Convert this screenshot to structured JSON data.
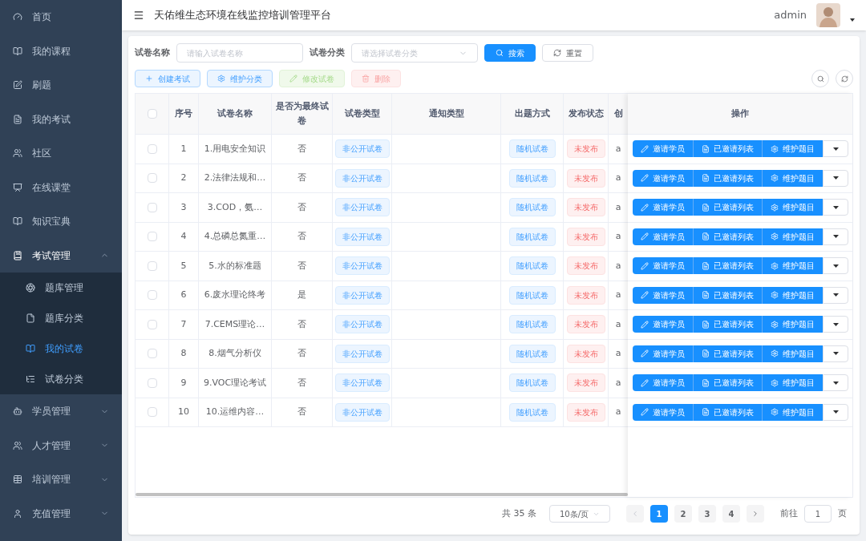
{
  "header": {
    "title": "天佑维生态环境在线监控培训管理平台",
    "user": "admin"
  },
  "sidebar": {
    "items": [
      {
        "label": "首页",
        "selected": false
      },
      {
        "label": "我的课程",
        "selected": false
      },
      {
        "label": "刷题",
        "selected": false
      },
      {
        "label": "我的考试",
        "selected": false
      },
      {
        "label": "社区",
        "selected": false
      },
      {
        "label": "在线课堂",
        "selected": false
      },
      {
        "label": "知识宝典",
        "selected": false
      },
      {
        "label": "考试管理",
        "selected": false,
        "expanded": true,
        "children": [
          {
            "label": "题库管理",
            "selected": false
          },
          {
            "label": "题库分类",
            "selected": false
          },
          {
            "label": "我的试卷",
            "selected": true
          },
          {
            "label": "试卷分类",
            "selected": false
          }
        ]
      },
      {
        "label": "学员管理",
        "selected": false,
        "expanded": false
      },
      {
        "label": "人才管理",
        "selected": false,
        "expanded": false
      },
      {
        "label": "培训管理",
        "selected": false,
        "expanded": false
      },
      {
        "label": "充值管理",
        "selected": false,
        "expanded": false
      }
    ]
  },
  "filters": [
    {
      "kind": "text",
      "label": "试卷名称",
      "placeholder": "请输入试卷名称"
    },
    {
      "kind": "select",
      "label": "试卷分类",
      "placeholder": "请选择试卷分类"
    }
  ],
  "filter_buttons": [
    {
      "kind": "primary",
      "label": "搜索"
    },
    {
      "kind": "default",
      "label": "重置"
    }
  ],
  "toolbar": [
    {
      "kind": "primary",
      "label": "创建考试",
      "disabled": false
    },
    {
      "kind": "primary",
      "label": "维护分类",
      "disabled": false
    },
    {
      "kind": "success",
      "label": "修改试卷",
      "disabled": true
    },
    {
      "kind": "danger",
      "label": "删除",
      "disabled": true
    }
  ],
  "table": {
    "select_all_checked": false,
    "columns": [
      "序号",
      "试卷名称",
      "是否为最终试卷",
      "试卷类型",
      "通知类型",
      "出题方式",
      "发布状态",
      "创",
      "操作"
    ],
    "rows": [
      {
        "checked": false,
        "index": "1",
        "name": "1.用电安全知识",
        "final": "否",
        "paper_type": "非公开试卷",
        "method": "随机试卷",
        "status": "未发布",
        "column_9": "a",
        "actions": [
          "邀请学员",
          "已邀请列表",
          "维护题目"
        ]
      },
      {
        "checked": false,
        "index": "2",
        "name": "2.法律法规和…",
        "final": "否",
        "paper_type": "非公开试卷",
        "method": "随机试卷",
        "status": "未发布",
        "column_9": "a",
        "actions": [
          "邀请学员",
          "已邀请列表",
          "维护题目"
        ]
      },
      {
        "checked": false,
        "index": "3",
        "name": "3.COD，氨…",
        "final": "否",
        "paper_type": "非公开试卷",
        "method": "随机试卷",
        "status": "未发布",
        "column_9": "a",
        "actions": [
          "邀请学员",
          "已邀请列表",
          "维护题目"
        ]
      },
      {
        "checked": false,
        "index": "4",
        "name": "4.总磷总氮重…",
        "final": "否",
        "paper_type": "非公开试卷",
        "method": "随机试卷",
        "status": "未发布",
        "column_9": "a",
        "actions": [
          "邀请学员",
          "已邀请列表",
          "维护题目"
        ]
      },
      {
        "checked": false,
        "index": "5",
        "name": "5.水的标准题",
        "final": "否",
        "paper_type": "非公开试卷",
        "method": "随机试卷",
        "status": "未发布",
        "column_9": "a",
        "actions": [
          "邀请学员",
          "已邀请列表",
          "维护题目"
        ]
      },
      {
        "checked": false,
        "index": "6",
        "name": "6.废水理论终考",
        "final": "是",
        "paper_type": "非公开试卷",
        "method": "随机试卷",
        "status": "未发布",
        "column_9": "a",
        "actions": [
          "邀请学员",
          "已邀请列表",
          "维护题目"
        ]
      },
      {
        "checked": false,
        "index": "7",
        "name": "7.CEMS理论…",
        "final": "否",
        "paper_type": "非公开试卷",
        "method": "随机试卷",
        "status": "未发布",
        "column_9": "a",
        "actions": [
          "邀请学员",
          "已邀请列表",
          "维护题目"
        ]
      },
      {
        "checked": false,
        "index": "8",
        "name": "8.烟气分析仪",
        "final": "否",
        "paper_type": "非公开试卷",
        "method": "随机试卷",
        "status": "未发布",
        "column_9": "a",
        "actions": [
          "邀请学员",
          "已邀请列表",
          "维护题目"
        ]
      },
      {
        "checked": false,
        "index": "9",
        "name": "9.VOC理论考试",
        "final": "否",
        "paper_type": "非公开试卷",
        "method": "随机试卷",
        "status": "未发布",
        "column_9": "a",
        "actions": [
          "邀请学员",
          "已邀请列表",
          "维护题目"
        ]
      },
      {
        "checked": false,
        "index": "10",
        "name": "10.运维内容…",
        "final": "否",
        "paper_type": "非公开试卷",
        "method": "随机试卷",
        "status": "未发布",
        "column_9": "a",
        "actions": [
          "邀请学员",
          "已邀请列表",
          "维护题目"
        ]
      }
    ]
  },
  "pagination": {
    "total": "共 35 条",
    "page_size": "10条/页",
    "pages": [
      {
        "label": "1",
        "selected": true
      },
      {
        "label": "2",
        "selected": false
      },
      {
        "label": "3",
        "selected": false
      },
      {
        "label": "4",
        "selected": false
      }
    ],
    "jump_label": "前往",
    "jump_value": "1",
    "jump_suffix": "页"
  }
}
